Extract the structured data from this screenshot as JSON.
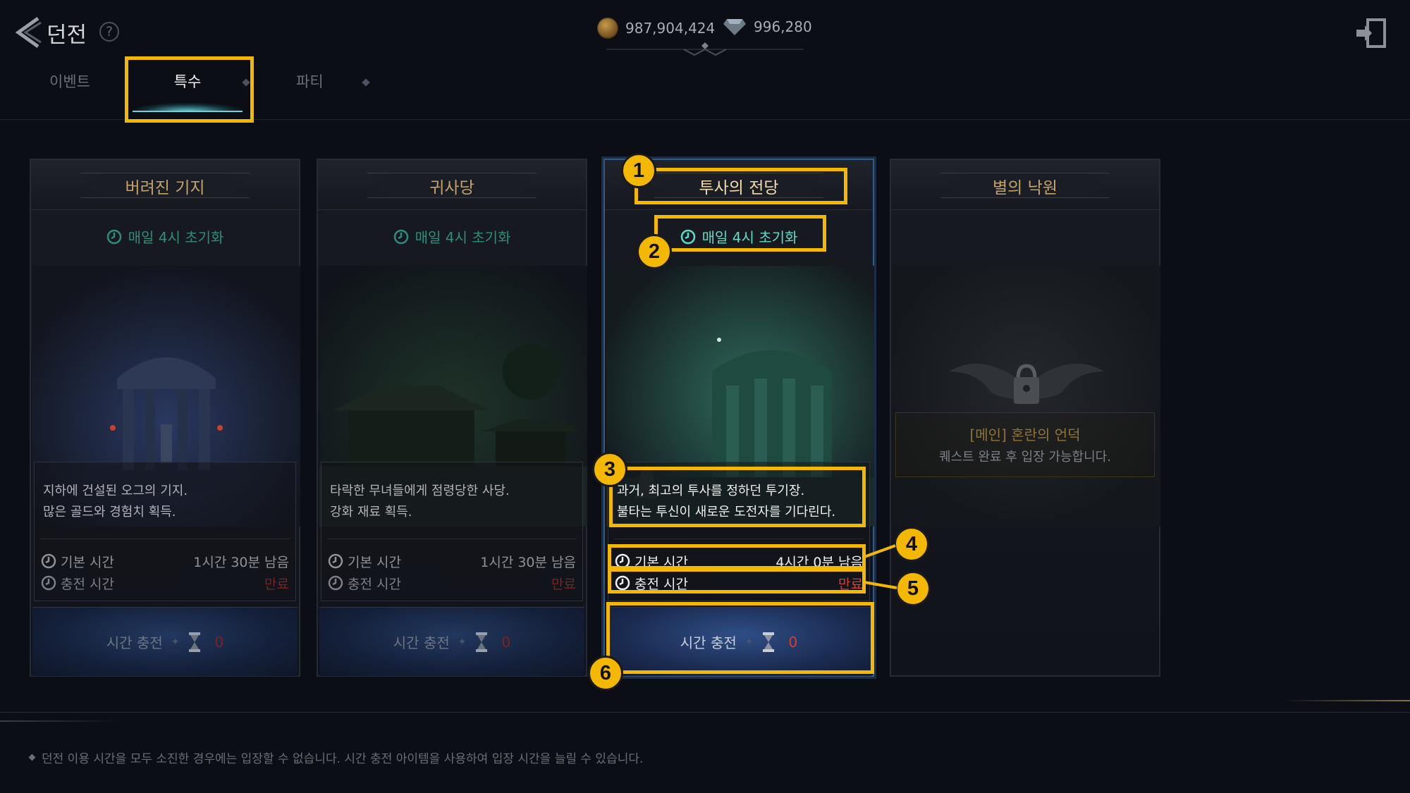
{
  "header": {
    "title": "던전",
    "help_glyph": "?",
    "gold_amount": "987,904,424",
    "gem_amount": "996,280"
  },
  "tabs": [
    {
      "label": "이벤트"
    },
    {
      "label": "특수",
      "selected": true
    },
    {
      "label": "파티"
    }
  ],
  "cards": [
    {
      "title": "버려진 기지",
      "reset": "매일 4시 초기화",
      "desc_line1": "지하에 건설된 오그의 기지.",
      "desc_line2": "많은 골드와 경험치 획득.",
      "base_label": "기본 시간",
      "base_value": "1시간 30분 남음",
      "charge_label": "충전 시간",
      "charge_value": "만료",
      "button_label": "시간 충전",
      "button_count": "0"
    },
    {
      "title": "귀사당",
      "reset": "매일 4시 초기화",
      "desc_line1": "타락한 무녀들에게 점령당한 사당.",
      "desc_line2": "강화 재료 획득.",
      "base_label": "기본 시간",
      "base_value": "1시간 30분 남음",
      "charge_label": "충전 시간",
      "charge_value": "만료",
      "button_label": "시간 충전",
      "button_count": "0"
    },
    {
      "title": "투사의 전당",
      "reset": "매일 4시 초기화",
      "desc_line1": "과거, 최고의 투사를 정하던 투기장.",
      "desc_line2": "불타는 투신이 새로운 도전자를 기다린다.",
      "base_label": "기본 시간",
      "base_value": "4시간 0분 남음",
      "charge_label": "충전 시간",
      "charge_value": "만료",
      "button_label": "시간 충전",
      "button_count": "0",
      "selected": true
    },
    {
      "title": "별의 낙원",
      "locked": true,
      "lock_title": "[메인] 혼란의 언덕",
      "lock_desc": "퀘스트 완료 후 입장 가능합니다."
    }
  ],
  "markers": [
    "1",
    "2",
    "3",
    "4",
    "5",
    "6"
  ],
  "footer": {
    "note": "던전 이용 시간을 모두 소진한 경우에는 입장할 수 없습니다. 시간 충전 아이템을 사용하여 입장 시간을 늘릴 수 있습니다."
  },
  "colors": {
    "highlight": "#f5b800",
    "reset_text": "#5fdcc8",
    "expired_text": "#e03a30",
    "title_gold": "#c4a36a"
  },
  "icons": [
    "back-arrow-icon",
    "help-icon",
    "gold-coin-icon",
    "gem-icon",
    "exit-icon",
    "clock-icon",
    "hourglass-icon",
    "lock-icon"
  ]
}
